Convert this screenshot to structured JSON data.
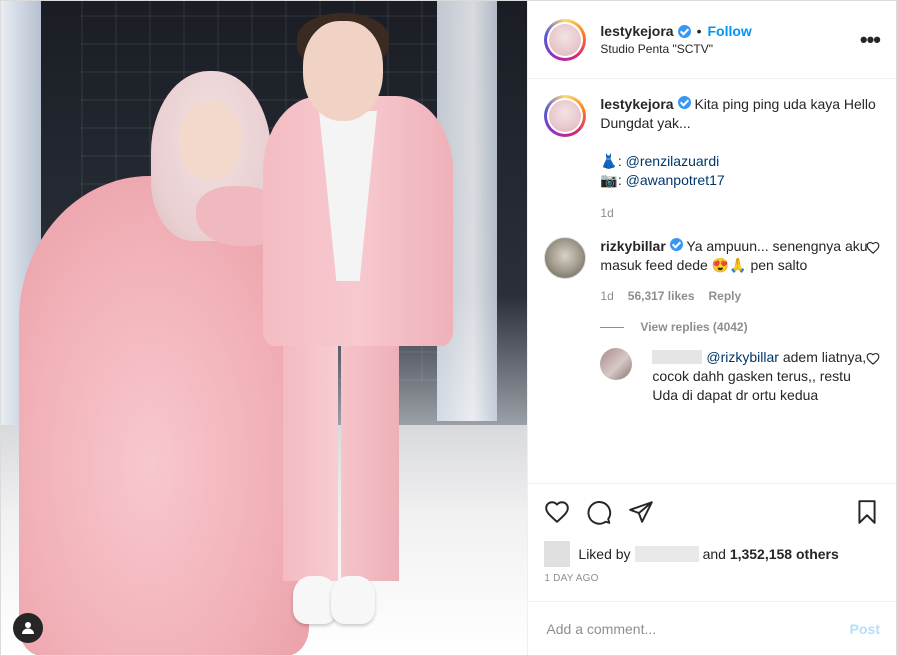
{
  "header": {
    "username": "lestykejora",
    "separator": "•",
    "follow_label": "Follow",
    "location": "Studio Penta \"SCTV\"",
    "more_icon": "more-horizontal-icon"
  },
  "caption": {
    "username": "lestykejora",
    "text": "Kita ping ping uda kaya Hello Dungdat yak...",
    "credit_1_emoji": "👗",
    "credit_1_mention": "@renzilazuardi",
    "credit_2_emoji": "📷",
    "credit_2_mention": "@awanpotret17",
    "time": "1d"
  },
  "comment": {
    "username": "rizkybillar",
    "text": "Ya ampuun... senengnya aku masuk feed dede 😍🙏 pen salto",
    "time": "1d",
    "likes": "56,317 likes",
    "reply_label": "Reply",
    "view_replies": "View replies (4042)"
  },
  "reply": {
    "mention": "@rizkybillar",
    "text": "adem liatnya, cocok dahh gasken terus,, restu Uda di dapat dr ortu kedua"
  },
  "likes": {
    "prefix": "Liked by",
    "connector": "and",
    "count": "1,352,158 others"
  },
  "timestamp": "1 DAY AGO",
  "add_comment": {
    "placeholder": "Add a comment...",
    "post_label": "Post"
  },
  "colors": {
    "accent": "#0095f6",
    "verified": "#3897f0",
    "post_disabled": "#b2dffc",
    "muted": "#8e8e8e"
  }
}
